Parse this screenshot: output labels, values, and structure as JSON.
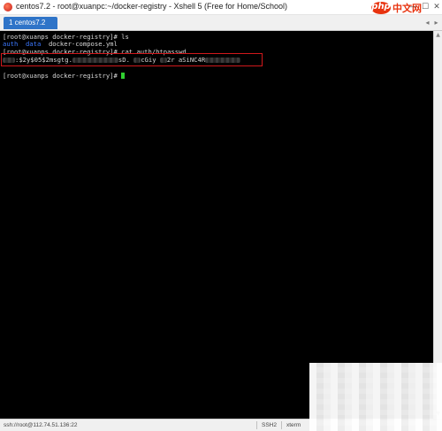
{
  "window": {
    "title": "centos7.2 - root@xuanpc:~/docker-registry - Xshell 5 (Free for Home/School)",
    "controls": {
      "minimize": "—",
      "maximize": "☐",
      "close": "✕"
    }
  },
  "brand": {
    "php": "php",
    "text": "中文网"
  },
  "tabs": [
    {
      "label": "1 centos7.2",
      "active": true
    }
  ],
  "tab_nav": {
    "left": "◂",
    "right": "▸"
  },
  "terminal": {
    "background": "#000000",
    "prompt_prefix": "[root@xuanps docker-registry]# ",
    "lines": {
      "l1_prompt": "[root@xuanps docker-registry]# ",
      "l1_cmd": "ls",
      "l2_dir1": "auth",
      "l2_dir2": "data",
      "l2_file": "docker-compose.yml",
      "l3_prompt": "[root@xuanps docker-registry]# ",
      "l3_cmd": "cat auth/htpasswd",
      "l4_part1": ":$2y$05$2msgtg.",
      "l4_part2": "sD.",
      "l4_part3": "cGiy",
      "l4_part4": "2r",
      "l4_part5": "aSiNC4R",
      "l5_prompt": "[root@xuanps docker-registry]# "
    },
    "cursor_color": "#30d030",
    "dir_color": "#3b78ff",
    "highlight_color": "#d0181b"
  },
  "scrollbar": {
    "up": "▲",
    "down": "▼"
  },
  "statusbar": {
    "session": "ssh://root@112.74.51.136:22",
    "protocol": "SSH2",
    "terminal_type": "xterm"
  }
}
